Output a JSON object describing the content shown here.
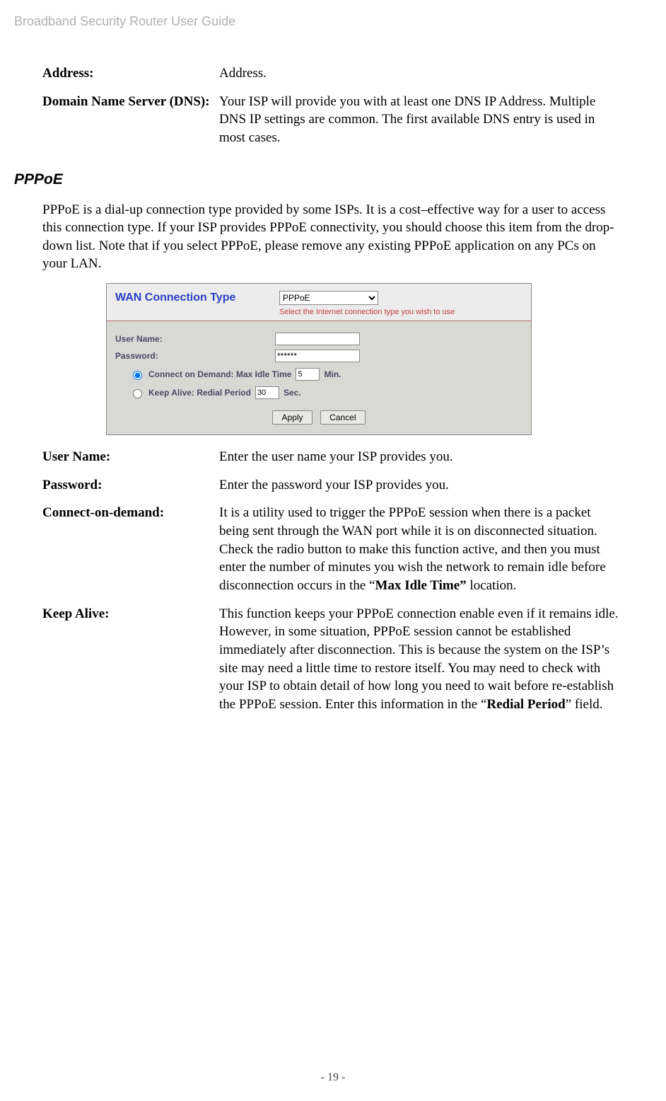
{
  "doc_header": "Broadband Security Router User Guide",
  "page_number": "- 19 -",
  "top_defs": [
    {
      "term": "Address:",
      "desc": "Address."
    },
    {
      "term": "Domain Name Server (DNS):",
      "desc": "Your ISP will provide you with at least one DNS IP Address. Multiple DNS IP settings are common. The first available DNS entry is used in most cases."
    }
  ],
  "section": {
    "heading": "PPPoE",
    "intro": "PPPoE is a dial-up connection type provided by some ISPs. It is a cost–effective way for a user to access this connection type. If your ISP provides PPPoE connectivity, you should choose this item from the drop-down list. Note that if you select PPPoE, please remove any existing PPPoE application on any PCs on your LAN."
  },
  "screenshot": {
    "title": "WAN Connection Type",
    "select_value": "PPPoE",
    "subtitle": "Select the Internet connection type you wish to use",
    "fields": {
      "user_name_label": "User Name:",
      "user_name_value": "",
      "password_label": "Password:",
      "password_value": "******"
    },
    "radios": {
      "cod_label": "Connect on Demand: Max Idle Time",
      "cod_value": "5",
      "cod_unit": "Min.",
      "ka_label": "Keep Alive: Redial Period",
      "ka_value": "30",
      "ka_unit": "Sec."
    },
    "buttons": {
      "apply": "Apply",
      "cancel": "Cancel"
    }
  },
  "defs": [
    {
      "term": "User Name:",
      "desc": "Enter the user name your ISP provides you."
    },
    {
      "term": "Password:",
      "desc": "Enter the password your ISP provides you."
    },
    {
      "term": "Connect-on-demand:",
      "desc_pre": "It is a utility used to trigger the PPPoE session when there is a packet being sent through the WAN port while it is on disconnected situation. Check the radio button to make this function active, and then you must enter the number of minutes you wish the network to remain idle before disconnection occurs in the “",
      "desc_bold": "Max Idle Time”",
      "desc_post": " location."
    },
    {
      "term": "Keep Alive:",
      "desc_pre": "This function keeps your PPPoE connection enable even if it remains idle. However, in some situation, PPPoE session cannot be established immediately after disconnection. This is because the system on the ISP’s site may need a little time to restore itself. You may need to check with your ISP to obtain detail of how long you need to wait before re-establish the PPPoE session. Enter this information in the “",
      "desc_bold": "Redial Period",
      "desc_post": "” field."
    }
  ]
}
